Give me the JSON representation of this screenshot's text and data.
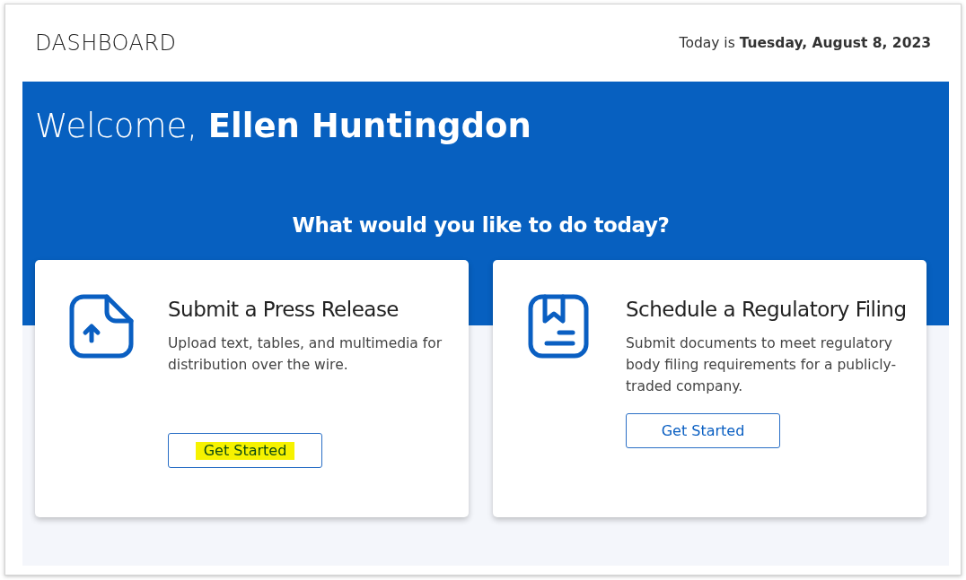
{
  "header": {
    "title": "DASHBOARD",
    "date": "Today is **Tuesday, August 8, 2023**"
  },
  "banner": {
    "greeting": "Welcome, **Ellen Huntingdon**",
    "prompt": "What would you like to do today?"
  },
  "actions": [
    {
      "kind": "upload",
      "title": "Submit a Press Release",
      "description": "Upload text, tables, and multimedia for distribution over the wire.",
      "button": "Get Started",
      "highlighted": true
    },
    {
      "kind": "bookmark",
      "title": "Schedule a Regulatory Filing",
      "description": "Submit documents to meet regulatory body filing requirements for a publicly-traded company.",
      "button": "Get Started",
      "highlighted": false
    }
  ]
}
